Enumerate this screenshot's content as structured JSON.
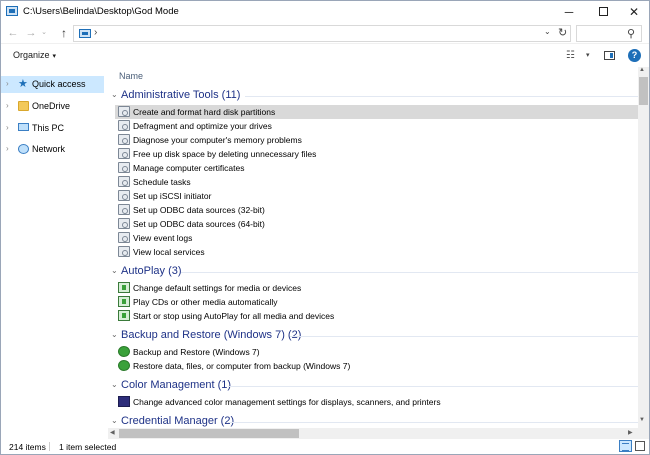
{
  "window": {
    "title": "C:\\Users\\Belinda\\Desktop\\God Mode",
    "minimize": "─",
    "close": "✕"
  },
  "address": {
    "chevron": "›",
    "dropdown": "⌄",
    "refresh": "↻",
    "search_placeholder": "",
    "search_icon": "⚲"
  },
  "nav_buttons": {
    "back": "←",
    "forward": "→",
    "recent": "⌄",
    "up": "↑"
  },
  "toolbar": {
    "organize": "Organize",
    "organize_caret": "▾",
    "view_caret": "▾",
    "help": "?",
    "view_options": "☷"
  },
  "sidebar": {
    "items": [
      {
        "label": "Quick access",
        "icon": "star-icon",
        "selected": true
      },
      {
        "label": "OneDrive",
        "icon": "folder-icon",
        "selected": false
      },
      {
        "label": "This PC",
        "icon": "computer-icon",
        "selected": false
      },
      {
        "label": "Network",
        "icon": "network-icon",
        "selected": false
      }
    ]
  },
  "list": {
    "column_header": "Name",
    "groups": [
      {
        "title": "Administrative Tools (11)",
        "icon": "admin-tools-icon",
        "items": [
          "Create and format hard disk partitions",
          "Defragment and optimize your drives",
          "Diagnose your computer's memory problems",
          "Free up disk space by deleting unnecessary files",
          "Manage computer certificates",
          "Schedule tasks",
          "Set up iSCSI initiator",
          "Set up ODBC data sources (32-bit)",
          "Set up ODBC data sources (64-bit)",
          "View event logs",
          "View local services"
        ]
      },
      {
        "title": "AutoPlay (3)",
        "icon": "autoplay-icon",
        "items": [
          "Change default settings for media or devices",
          "Play CDs or other media automatically",
          "Start or stop using AutoPlay for all media and devices"
        ]
      },
      {
        "title": "Backup and Restore (Windows 7) (2)",
        "icon": "backup-icon",
        "items": [
          "Backup and Restore (Windows 7)",
          "Restore data, files, or computer from backup (Windows 7)"
        ]
      },
      {
        "title": "Color Management (1)",
        "icon": "color-management-icon",
        "items": [
          "Change advanced color management settings for displays, scanners, and printers"
        ]
      },
      {
        "title": "Credential Manager (2)",
        "icon": "credential-icon",
        "items": []
      }
    ],
    "selected_item": "Create and format hard disk partitions"
  },
  "status": {
    "count": "214 items",
    "selection": "1 item selected"
  },
  "colors": {
    "accent": "#1e6fb8",
    "group_title": "#1e3287",
    "selection": "#cce8ff",
    "row_selected": "#d9d9d9"
  }
}
